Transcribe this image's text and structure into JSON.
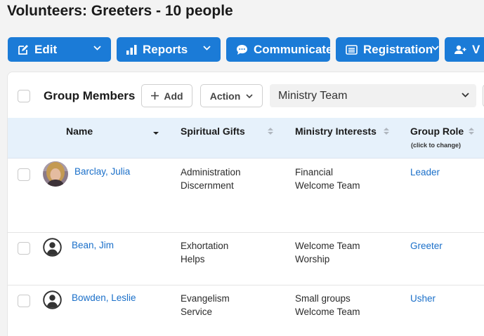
{
  "page": {
    "title": "Volunteers: Greeters - 10 people"
  },
  "colors": {
    "accent": "#1b7bd7",
    "link": "#1a6fc9",
    "header_bg": "#e6f1fb"
  },
  "toolbar": {
    "buttons": [
      {
        "label": "Edit",
        "icon": "edit-icon",
        "has_dropdown": true
      },
      {
        "label": "Reports",
        "icon": "bar-chart-icon",
        "has_dropdown": true
      },
      {
        "label": "Communicate",
        "icon": "chat-bubble-icon",
        "has_dropdown": false
      },
      {
        "label": "Registration",
        "icon": "list-icon",
        "has_dropdown": true
      },
      {
        "label": "V",
        "icon": "user-add-icon",
        "has_dropdown": false
      }
    ]
  },
  "members": {
    "title": "Group Members",
    "add_label": "Add",
    "action_label": "Action",
    "filter": {
      "selected": "Ministry Team"
    },
    "columns": {
      "name": "Name",
      "gifts": "Spiritual Gifts",
      "interests": "Ministry Interests",
      "role": "Group Role",
      "role_hint": "(click to change)"
    },
    "rows": [
      {
        "name": "Barclay, Julia",
        "avatar": "photo",
        "gifts": [
          "Administration",
          "Discernment"
        ],
        "interests": [
          "Financial",
          "Welcome Team"
        ],
        "role": "Leader"
      },
      {
        "name": "Bean, Jim",
        "avatar": "person-icon",
        "gifts": [
          "Exhortation",
          "Helps"
        ],
        "interests": [
          "Welcome Team",
          "Worship"
        ],
        "role": "Greeter"
      },
      {
        "name": "Bowden, Leslie",
        "avatar": "person-icon",
        "gifts": [
          "Evangelism",
          "Service"
        ],
        "interests": [
          "Small groups",
          "Welcome Team"
        ],
        "role": "Usher"
      }
    ]
  }
}
